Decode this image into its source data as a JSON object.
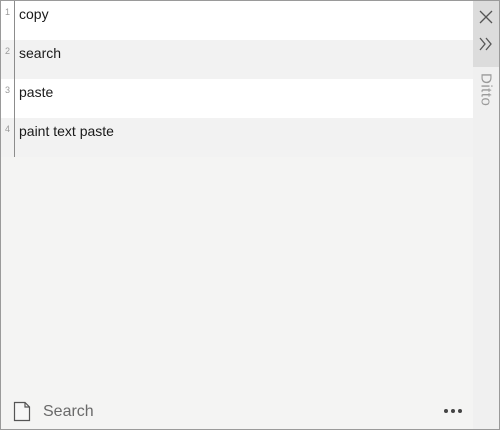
{
  "app": {
    "name": "Ditto"
  },
  "clips": [
    {
      "num": "1",
      "text": "copy"
    },
    {
      "num": "2",
      "text": "search"
    },
    {
      "num": "3",
      "text": "paste"
    },
    {
      "num": "4",
      "text": "paint text paste"
    }
  ],
  "search": {
    "placeholder": "Search",
    "value": ""
  },
  "icons": {
    "close": "close-icon",
    "collapse": "double-chevron-right-icon",
    "note": "note-icon",
    "more": "more-dots-icon"
  },
  "colors": {
    "row_odd": "#ffffff",
    "row_even": "#f2f2f2",
    "side_panel": "#f0f0f0",
    "side_top": "#dcdcdc"
  }
}
